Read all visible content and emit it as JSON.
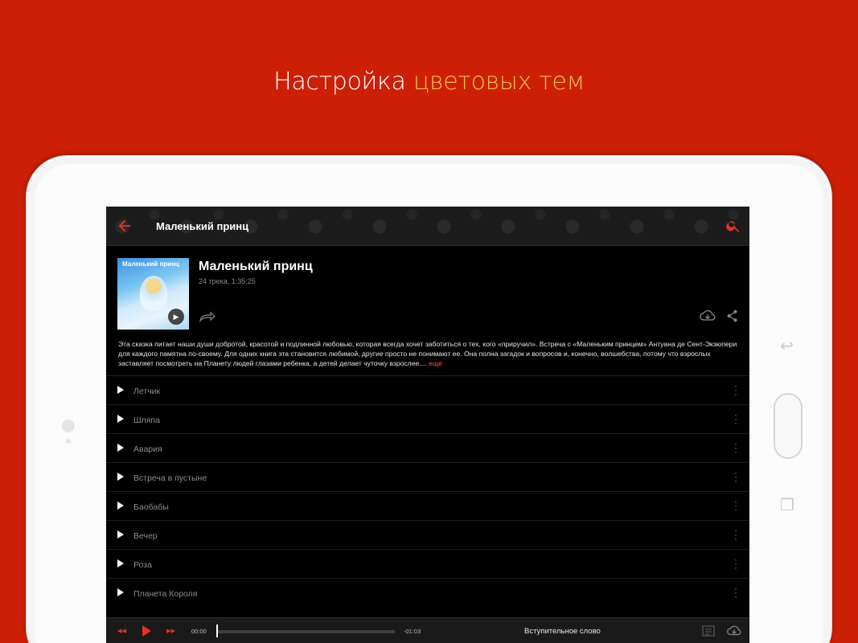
{
  "promo": {
    "title_plain": "Настройка ",
    "title_accent": "цветовых тем"
  },
  "colors": {
    "background": "#cc1f06",
    "accent": "#e53321",
    "title_accent": "#f6c344"
  },
  "appbar": {
    "title": "Маленький принц",
    "back_icon": "arrow-left-icon",
    "search_icon": "search-icon"
  },
  "book": {
    "cover_text": "Маленький принц",
    "title": "Маленький принц",
    "meta": "24 трека, 1:35:25",
    "description": "Эта сказка питает наши души добротой, красотой и подлинной любовью, которая всегда хочет заботиться о тех, кого «приручил». Встреча с «Маленьким принцем» Антуана де Сент-Экзюпери для каждого памятна по-своему. Для одних книга эта становится любимой, другие просто не понимают ее. Она полна загадок и вопросов и, конечно, волшебства, потому что взрослых заставляет посмотреть на Планету людей глазами ребенка, а детей делает чуточку взрослее....",
    "more": "ещё"
  },
  "tracks": [
    {
      "name": "Летчик"
    },
    {
      "name": "Шляпа"
    },
    {
      "name": "Авария"
    },
    {
      "name": "Встреча в пустыне"
    },
    {
      "name": "Баобабы"
    },
    {
      "name": "Вечер"
    },
    {
      "name": "Роза"
    },
    {
      "name": "Планета Короля"
    }
  ],
  "player": {
    "elapsed": "00:00",
    "remaining": "-01:03",
    "now_playing": "Вступительное слово",
    "progress": 0.0
  }
}
